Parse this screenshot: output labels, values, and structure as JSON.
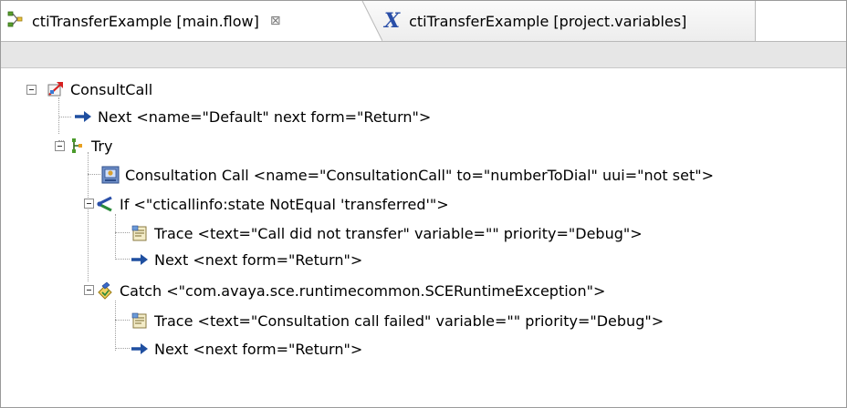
{
  "tabs": [
    {
      "label": "ctiTransferExample [main.flow]",
      "close_glyph": "⊠",
      "icon": "flow-icon",
      "active": true
    },
    {
      "label": "ctiTransferExample [project.variables]",
      "icon_text": "X",
      "icon": "variables-x-icon",
      "active": false
    }
  ],
  "tree": {
    "root": {
      "label": "ConsultCall",
      "icon": "consultcall-flow-icon"
    },
    "next_default": {
      "label": "Next <name=\"Default\" next form=\"Return\">",
      "icon": "arrow-right-icon"
    },
    "try": {
      "label": "Try",
      "icon": "try-icon"
    },
    "consultation_call": {
      "label": "Consultation Call <name=\"ConsultationCall\" to=\"numberToDial\" uui=\"not set\">",
      "icon": "consultation-call-icon"
    },
    "if_node": {
      "label": "If <\"cticallinfo:state NotEqual 'transferred'\">",
      "icon": "if-branch-icon"
    },
    "trace_if": {
      "label": "Trace <text=\"Call did not transfer\" variable=\"\" priority=\"Debug\">",
      "icon": "trace-icon"
    },
    "next_if": {
      "label": "Next <next form=\"Return\">",
      "icon": "arrow-right-icon"
    },
    "catch_node": {
      "label": "Catch <\"com.avaya.sce.runtimecommon.SCERuntimeException\">",
      "icon": "catch-icon"
    },
    "trace_catch": {
      "label": "Trace <text=\"Consultation call failed\" variable=\"\" priority=\"Debug\">",
      "icon": "trace-icon"
    },
    "next_catch": {
      "label": "Next <next form=\"Return\">",
      "icon": "arrow-right-icon"
    }
  },
  "colors": {
    "arrow_blue": "#1f4fa0",
    "tab_x_blue": "#2a4fa8",
    "toolbar_gray": "#e6e6e6"
  }
}
